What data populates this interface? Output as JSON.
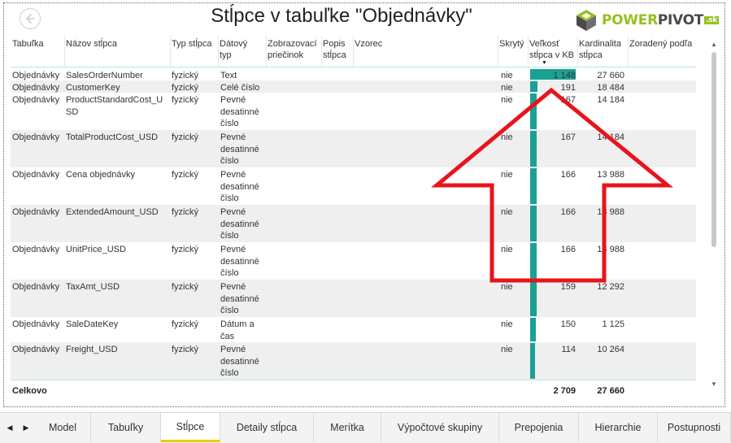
{
  "page": {
    "title": "Stĺpce v tabuľke \"Objednávky\"",
    "back_icon": "back-arrow-icon"
  },
  "logo": {
    "part1": "POWER",
    "part2": "PIVOT",
    "suffix": ".sk",
    "icon": "powerpivot-cube-icon",
    "colors": {
      "green": "#95c11f",
      "dark": "#4a4a4a"
    }
  },
  "table": {
    "headers": [
      {
        "id": "tabulka",
        "label": "Tabuľka"
      },
      {
        "id": "nazov",
        "label": "Názov stĺpca"
      },
      {
        "id": "typ",
        "label": "Typ stĺpca"
      },
      {
        "id": "datovy",
        "label": "Dátový typ"
      },
      {
        "id": "zobraz",
        "label": "Zobrazovací priečinok"
      },
      {
        "id": "popis",
        "label": "Popis stĺpca"
      },
      {
        "id": "vzorec",
        "label": "Vzorec"
      },
      {
        "id": "skryty",
        "label": "Skrytý"
      },
      {
        "id": "velkost",
        "label": "Veľkosť stĺpca v KB"
      },
      {
        "id": "kardinalita",
        "label": "Kardinalita stĺpca"
      },
      {
        "id": "zoradeny",
        "label": "Zoradený podľa"
      }
    ],
    "rows": [
      {
        "tabulka": "Objednávky",
        "nazov": "SalesOrderNumber",
        "typ": "fyzický",
        "datovy": "Text",
        "skryty": "nie",
        "velkost": "1 148",
        "size": 1148,
        "kardinalita": "27 660"
      },
      {
        "tabulka": "Objednávky",
        "nazov": "CustomerKey",
        "typ": "fyzický",
        "datovy": "Celé číslo",
        "skryty": "nie",
        "velkost": "191",
        "size": 191,
        "kardinalita": "18 484"
      },
      {
        "tabulka": "Objednávky",
        "nazov": "ProductStandardCost_USD",
        "typ": "fyzický",
        "datovy": "Pevné desatinné číslo",
        "skryty": "nie",
        "velkost": "167",
        "size": 167,
        "kardinalita": "14 184"
      },
      {
        "tabulka": "Objednávky",
        "nazov": "TotalProductCost_USD",
        "typ": "fyzický",
        "datovy": "Pevné desatinné číslo",
        "skryty": "nie",
        "velkost": "167",
        "size": 167,
        "kardinalita": "14 184"
      },
      {
        "tabulka": "Objednávky",
        "nazov": "Cena objednávky",
        "typ": "fyzický",
        "datovy": "Pevné desatinné číslo",
        "skryty": "nie",
        "velkost": "166",
        "size": 166,
        "kardinalita": "13 988"
      },
      {
        "tabulka": "Objednávky",
        "nazov": "ExtendedAmount_USD",
        "typ": "fyzický",
        "datovy": "Pevné desatinné číslo",
        "skryty": "nie",
        "velkost": "166",
        "size": 166,
        "kardinalita": "13 988"
      },
      {
        "tabulka": "Objednávky",
        "nazov": "UnitPrice_USD",
        "typ": "fyzický",
        "datovy": "Pevné desatinné číslo",
        "skryty": "nie",
        "velkost": "166",
        "size": 166,
        "kardinalita": "13 988"
      },
      {
        "tabulka": "Objednávky",
        "nazov": "TaxAmt_USD",
        "typ": "fyzický",
        "datovy": "Pevné desatinné číslo",
        "skryty": "nie",
        "velkost": "159",
        "size": 159,
        "kardinalita": "12 292"
      },
      {
        "tabulka": "Objednávky",
        "nazov": "SaleDateKey",
        "typ": "fyzický",
        "datovy": "Dátum a čas",
        "skryty": "nie",
        "velkost": "150",
        "size": 150,
        "kardinalita": "1 125"
      },
      {
        "tabulka": "Objednávky",
        "nazov": "Freight_USD",
        "typ": "fyzický",
        "datovy": "Pevné desatinné číslo",
        "skryty": "nie",
        "velkost": "114",
        "size": 114,
        "kardinalita": "10 264"
      }
    ],
    "total": {
      "label": "Celkovo",
      "velkost": "2 709",
      "kardinalita": "27 660"
    },
    "bar_color": "#1aa193"
  },
  "annotation": {
    "color": "#e8141c",
    "icon": "big-up-arrow-icon"
  },
  "tabs": {
    "items": [
      "Model",
      "Tabuľky",
      "Stĺpce",
      "Detaily stĺpca",
      "Merítka",
      "Výpočtové skupiny",
      "Prepojenia",
      "Hierarchie",
      "Postupnosti"
    ],
    "active": "Stĺpce",
    "accent": "#f2c80f"
  }
}
